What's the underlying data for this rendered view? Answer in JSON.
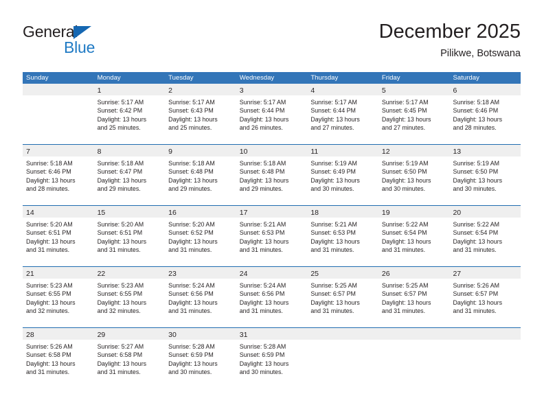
{
  "brand": {
    "name_top": "General",
    "name_bottom": "Blue",
    "triangle_icon": "brand-triangle-icon",
    "color_dark": "#231f20",
    "color_blue": "#1f7ac4"
  },
  "header": {
    "title": "December 2025",
    "subtitle": "Pilikwe, Botswana"
  },
  "theme": {
    "header_blue": "#3375b8",
    "row_separator_blue": "#1f6cb0",
    "day_band_gray": "#efefef",
    "text": "#231f20"
  },
  "weekdays": [
    "Sunday",
    "Monday",
    "Tuesday",
    "Wednesday",
    "Thursday",
    "Friday",
    "Saturday"
  ],
  "weeks": [
    [
      {
        "day": "",
        "lines": [],
        "empty": true
      },
      {
        "day": "1",
        "lines": [
          "Sunrise: 5:17 AM",
          "Sunset: 6:42 PM",
          "Daylight: 13 hours",
          "and 25 minutes."
        ],
        "empty": false
      },
      {
        "day": "2",
        "lines": [
          "Sunrise: 5:17 AM",
          "Sunset: 6:43 PM",
          "Daylight: 13 hours",
          "and 25 minutes."
        ],
        "empty": false
      },
      {
        "day": "3",
        "lines": [
          "Sunrise: 5:17 AM",
          "Sunset: 6:44 PM",
          "Daylight: 13 hours",
          "and 26 minutes."
        ],
        "empty": false
      },
      {
        "day": "4",
        "lines": [
          "Sunrise: 5:17 AM",
          "Sunset: 6:44 PM",
          "Daylight: 13 hours",
          "and 27 minutes."
        ],
        "empty": false
      },
      {
        "day": "5",
        "lines": [
          "Sunrise: 5:17 AM",
          "Sunset: 6:45 PM",
          "Daylight: 13 hours",
          "and 27 minutes."
        ],
        "empty": false
      },
      {
        "day": "6",
        "lines": [
          "Sunrise: 5:18 AM",
          "Sunset: 6:46 PM",
          "Daylight: 13 hours",
          "and 28 minutes."
        ],
        "empty": false
      }
    ],
    [
      {
        "day": "7",
        "lines": [
          "Sunrise: 5:18 AM",
          "Sunset: 6:46 PM",
          "Daylight: 13 hours",
          "and 28 minutes."
        ],
        "empty": false
      },
      {
        "day": "8",
        "lines": [
          "Sunrise: 5:18 AM",
          "Sunset: 6:47 PM",
          "Daylight: 13 hours",
          "and 29 minutes."
        ],
        "empty": false
      },
      {
        "day": "9",
        "lines": [
          "Sunrise: 5:18 AM",
          "Sunset: 6:48 PM",
          "Daylight: 13 hours",
          "and 29 minutes."
        ],
        "empty": false
      },
      {
        "day": "10",
        "lines": [
          "Sunrise: 5:18 AM",
          "Sunset: 6:48 PM",
          "Daylight: 13 hours",
          "and 29 minutes."
        ],
        "empty": false
      },
      {
        "day": "11",
        "lines": [
          "Sunrise: 5:19 AM",
          "Sunset: 6:49 PM",
          "Daylight: 13 hours",
          "and 30 minutes."
        ],
        "empty": false
      },
      {
        "day": "12",
        "lines": [
          "Sunrise: 5:19 AM",
          "Sunset: 6:50 PM",
          "Daylight: 13 hours",
          "and 30 minutes."
        ],
        "empty": false
      },
      {
        "day": "13",
        "lines": [
          "Sunrise: 5:19 AM",
          "Sunset: 6:50 PM",
          "Daylight: 13 hours",
          "and 30 minutes."
        ],
        "empty": false
      }
    ],
    [
      {
        "day": "14",
        "lines": [
          "Sunrise: 5:20 AM",
          "Sunset: 6:51 PM",
          "Daylight: 13 hours",
          "and 31 minutes."
        ],
        "empty": false
      },
      {
        "day": "15",
        "lines": [
          "Sunrise: 5:20 AM",
          "Sunset: 6:51 PM",
          "Daylight: 13 hours",
          "and 31 minutes."
        ],
        "empty": false
      },
      {
        "day": "16",
        "lines": [
          "Sunrise: 5:20 AM",
          "Sunset: 6:52 PM",
          "Daylight: 13 hours",
          "and 31 minutes."
        ],
        "empty": false
      },
      {
        "day": "17",
        "lines": [
          "Sunrise: 5:21 AM",
          "Sunset: 6:53 PM",
          "Daylight: 13 hours",
          "and 31 minutes."
        ],
        "empty": false
      },
      {
        "day": "18",
        "lines": [
          "Sunrise: 5:21 AM",
          "Sunset: 6:53 PM",
          "Daylight: 13 hours",
          "and 31 minutes."
        ],
        "empty": false
      },
      {
        "day": "19",
        "lines": [
          "Sunrise: 5:22 AM",
          "Sunset: 6:54 PM",
          "Daylight: 13 hours",
          "and 31 minutes."
        ],
        "empty": false
      },
      {
        "day": "20",
        "lines": [
          "Sunrise: 5:22 AM",
          "Sunset: 6:54 PM",
          "Daylight: 13 hours",
          "and 31 minutes."
        ],
        "empty": false
      }
    ],
    [
      {
        "day": "21",
        "lines": [
          "Sunrise: 5:23 AM",
          "Sunset: 6:55 PM",
          "Daylight: 13 hours",
          "and 32 minutes."
        ],
        "empty": false
      },
      {
        "day": "22",
        "lines": [
          "Sunrise: 5:23 AM",
          "Sunset: 6:55 PM",
          "Daylight: 13 hours",
          "and 32 minutes."
        ],
        "empty": false
      },
      {
        "day": "23",
        "lines": [
          "Sunrise: 5:24 AM",
          "Sunset: 6:56 PM",
          "Daylight: 13 hours",
          "and 31 minutes."
        ],
        "empty": false
      },
      {
        "day": "24",
        "lines": [
          "Sunrise: 5:24 AM",
          "Sunset: 6:56 PM",
          "Daylight: 13 hours",
          "and 31 minutes."
        ],
        "empty": false
      },
      {
        "day": "25",
        "lines": [
          "Sunrise: 5:25 AM",
          "Sunset: 6:57 PM",
          "Daylight: 13 hours",
          "and 31 minutes."
        ],
        "empty": false
      },
      {
        "day": "26",
        "lines": [
          "Sunrise: 5:25 AM",
          "Sunset: 6:57 PM",
          "Daylight: 13 hours",
          "and 31 minutes."
        ],
        "empty": false
      },
      {
        "day": "27",
        "lines": [
          "Sunrise: 5:26 AM",
          "Sunset: 6:57 PM",
          "Daylight: 13 hours",
          "and 31 minutes."
        ],
        "empty": false
      }
    ],
    [
      {
        "day": "28",
        "lines": [
          "Sunrise: 5:26 AM",
          "Sunset: 6:58 PM",
          "Daylight: 13 hours",
          "and 31 minutes."
        ],
        "empty": false
      },
      {
        "day": "29",
        "lines": [
          "Sunrise: 5:27 AM",
          "Sunset: 6:58 PM",
          "Daylight: 13 hours",
          "and 31 minutes."
        ],
        "empty": false
      },
      {
        "day": "30",
        "lines": [
          "Sunrise: 5:28 AM",
          "Sunset: 6:59 PM",
          "Daylight: 13 hours",
          "and 30 minutes."
        ],
        "empty": false
      },
      {
        "day": "31",
        "lines": [
          "Sunrise: 5:28 AM",
          "Sunset: 6:59 PM",
          "Daylight: 13 hours",
          "and 30 minutes."
        ],
        "empty": false
      },
      {
        "day": "",
        "lines": [],
        "empty": true
      },
      {
        "day": "",
        "lines": [],
        "empty": true
      },
      {
        "day": "",
        "lines": [],
        "empty": true
      }
    ]
  ]
}
